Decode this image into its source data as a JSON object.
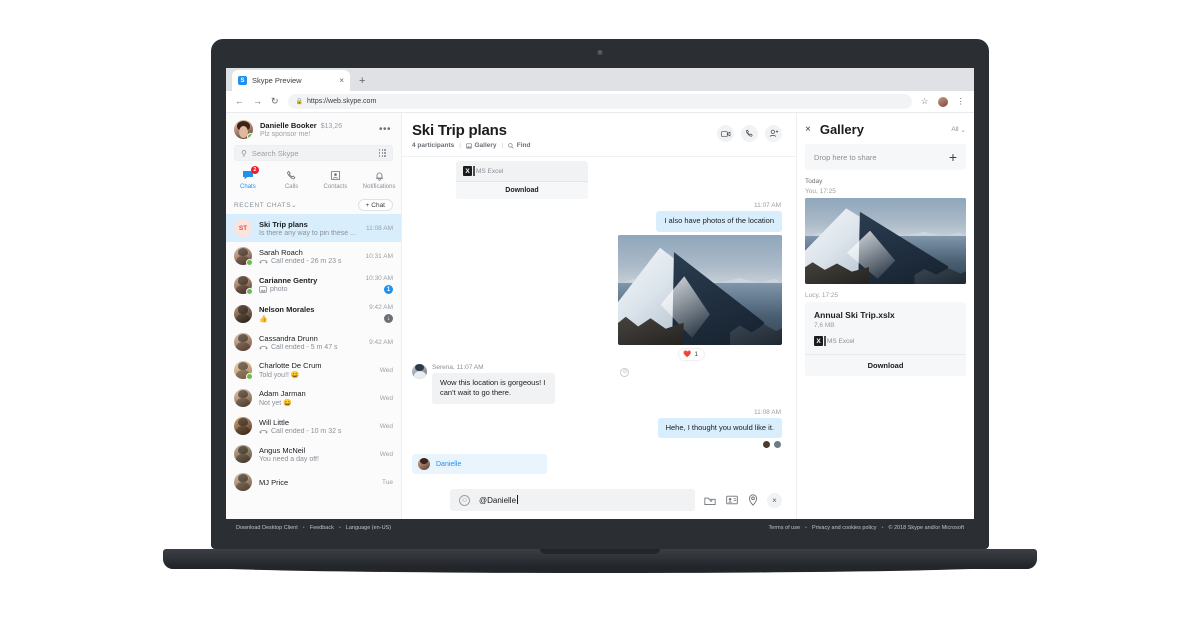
{
  "browser": {
    "tab": {
      "title": "Skype Preview",
      "favicon": "skype-icon",
      "close": "×"
    },
    "new_tab": "+",
    "nav": {
      "back": "←",
      "forward": "→",
      "reload": "↻"
    },
    "omnibox": {
      "lock": "🔒",
      "url": "https://web.skype.com"
    },
    "star": "☆",
    "menu": "⋮"
  },
  "sidebar": {
    "me": {
      "name": "Danielle Booker",
      "credit": "$13,26",
      "mood": "Plz sponsor me!",
      "more": "•••"
    },
    "search": {
      "placeholder": "Search Skype",
      "icon": "search-icon",
      "dialpad": "dialpad-icon"
    },
    "nav_tabs": [
      {
        "label": "Chats",
        "icon": "chat-icon",
        "badge": "2",
        "active": true
      },
      {
        "label": "Calls",
        "icon": "phone-icon",
        "badge": "",
        "active": false
      },
      {
        "label": "Contacts",
        "icon": "contacts-icon",
        "badge": "",
        "active": false
      },
      {
        "label": "Notifications",
        "icon": "bell-icon",
        "badge": "",
        "active": false
      }
    ],
    "recent_label": "RECENT CHATS",
    "new_chat": "+ Chat",
    "chats": [
      {
        "name": "Ski Trip plans",
        "preview": "Is there any way to pin these ...",
        "time": "11:08 AM",
        "initials": "ST",
        "selected": true,
        "unread": false,
        "badge": "",
        "badge_style": "",
        "preview_icon": ""
      },
      {
        "name": "Sarah Roach",
        "preview": "Call ended - 26 m 23 s",
        "time": "10:31 AM",
        "initials": "",
        "selected": false,
        "unread": false,
        "badge": "",
        "badge_style": "",
        "preview_icon": "call-ended-icon"
      },
      {
        "name": "Carianne Gentry",
        "preview": "photo",
        "time": "10:30 AM",
        "initials": "",
        "selected": false,
        "unread": true,
        "badge": "1",
        "badge_style": "blue",
        "preview_icon": "photo-icon"
      },
      {
        "name": "Nelson Morales",
        "preview": "👍",
        "time": "9:42 AM",
        "initials": "",
        "selected": false,
        "unread": true,
        "badge": "↓",
        "badge_style": "gray",
        "preview_icon": ""
      },
      {
        "name": "Cassandra Drunn",
        "preview": "Call ended - 5 m 47 s",
        "time": "9:42 AM",
        "initials": "",
        "selected": false,
        "unread": false,
        "badge": "",
        "badge_style": "",
        "preview_icon": "call-ended-icon"
      },
      {
        "name": "Charlotte De Crum",
        "preview": "Told you!! 😄",
        "time": "Wed",
        "initials": "",
        "selected": false,
        "unread": false,
        "badge": "",
        "badge_style": "",
        "preview_icon": ""
      },
      {
        "name": "Adam Jarman",
        "preview": "Not yet 😄",
        "time": "Wed",
        "initials": "",
        "selected": false,
        "unread": false,
        "badge": "",
        "badge_style": "",
        "preview_icon": ""
      },
      {
        "name": "Will Little",
        "preview": "Call ended - 10 m 32 s",
        "time": "Wed",
        "initials": "",
        "selected": false,
        "unread": false,
        "badge": "",
        "badge_style": "",
        "preview_icon": "call-ended-icon"
      },
      {
        "name": "Angus McNeil",
        "preview": "You need a day off!",
        "time": "Wed",
        "initials": "",
        "selected": false,
        "unread": false,
        "badge": "",
        "badge_style": "",
        "preview_icon": ""
      },
      {
        "name": "MJ Price",
        "preview": "",
        "time": "Tue",
        "initials": "",
        "selected": false,
        "unread": false,
        "badge": "",
        "badge_style": "",
        "preview_icon": ""
      }
    ]
  },
  "conversation": {
    "title": "Ski Trip plans",
    "participants": "4 participants",
    "gallery_link": "Gallery",
    "find_link": "Find",
    "actions": [
      {
        "name": "video-call-button",
        "icon": "video-camera-icon"
      },
      {
        "name": "audio-call-button",
        "icon": "phone-icon"
      },
      {
        "name": "add-people-button",
        "icon": "add-person-icon"
      }
    ],
    "file_card": {
      "app": "MS Excel",
      "download": "Download"
    },
    "messages": [
      {
        "id": "m1",
        "time": "11:07 AM",
        "side": "out",
        "text": "I also have photos of the location"
      },
      {
        "id": "m2",
        "side": "out",
        "type": "image",
        "reaction_emoji": "❤️",
        "reaction_count": "1"
      },
      {
        "id": "m3",
        "side": "in",
        "sender": "Serena, 11:07 AM",
        "text": "Wow this location is gorgeous! I can't wait to go there."
      },
      {
        "id": "m4",
        "time": "11:08 AM",
        "side": "out",
        "text": "Hehe, I thought you would like it."
      }
    ],
    "mention_suggestion": "Danielle",
    "composer": {
      "value": "@Danielle",
      "emoji_icon": "emoji-icon",
      "tools": [
        {
          "name": "send-file-button",
          "icon": "file-icon"
        },
        {
          "name": "send-contact-button",
          "icon": "contact-card-icon"
        },
        {
          "name": "send-location-button",
          "icon": "location-pin-icon"
        }
      ],
      "close": "×"
    }
  },
  "gallery": {
    "close": "×",
    "title": "Gallery",
    "filter": "All",
    "filter_icon": "chevron-down-icon",
    "drop_label": "Drop here to share",
    "add": "+",
    "day_label": "Today",
    "photo_author": "You, 17:25",
    "file_author": "Lucy, 17:25",
    "file": {
      "name": "Annual Ski Trip.xslx",
      "size": "7,6 MB",
      "app": "MS Excel",
      "download": "Download"
    }
  },
  "footer": {
    "left": [
      "Download Desktop Client",
      "Feedback",
      "Language (en-US)"
    ],
    "right": [
      "Terms of use",
      "Privacy and cookies policy",
      "© 2018 Skype and/or Microsoft"
    ],
    "separator": "•"
  },
  "colors": {
    "accent": "#1f8ff0",
    "outgoing_bubble": "#d9eefc",
    "incoming_bubble": "#f1f2f4",
    "badge_red": "#e8212c",
    "laptop": "#2b2e33"
  }
}
